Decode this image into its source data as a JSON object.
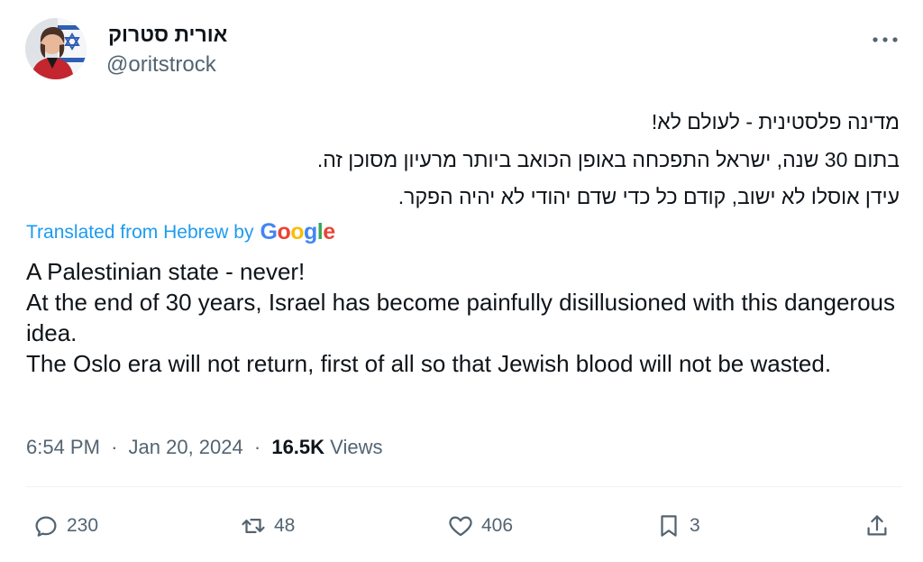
{
  "author": {
    "display_name": "אורית סטרוק",
    "handle": "@oritstrock"
  },
  "tweet": {
    "hebrew_lines": [
      "מדינה פלסטינית - לעולם לא!",
      "בתום 30 שנה, ישראל התפכחה באופן הכואב ביותר מרעיון מסוכן זה.",
      "עידן אוסלו לא ישוב, קודם כל כדי שדם יהודי לא יהיה הפקר."
    ],
    "translated_label": "Translated from Hebrew by",
    "translator_brand": "Google",
    "translation_lines": [
      "A Palestinian state - never!",
      "At the end of 30 years, Israel has become painfully disillusioned with this dangerous idea.",
      "The Oslo era will not return, first of all so that Jewish blood will not be wasted."
    ]
  },
  "meta": {
    "time": "6:54 PM",
    "date": "Jan 20, 2024",
    "views_count": "16.5K",
    "views_label": "Views",
    "separator": "·"
  },
  "actions": {
    "replies": "230",
    "retweets": "48",
    "likes": "406",
    "bookmarks": "3"
  },
  "colors": {
    "link_blue": "#1d9bf0",
    "secondary_text": "#536471",
    "primary_text": "#0f1419",
    "google_blue": "#4285F4",
    "google_red": "#EA4335",
    "google_yellow": "#FBBC05",
    "google_green": "#34A853"
  },
  "icons": {
    "more": "more-horizontal-icon",
    "reply": "reply-icon",
    "retweet": "retweet-icon",
    "like": "heart-icon",
    "bookmark": "bookmark-icon",
    "share": "share-icon"
  }
}
